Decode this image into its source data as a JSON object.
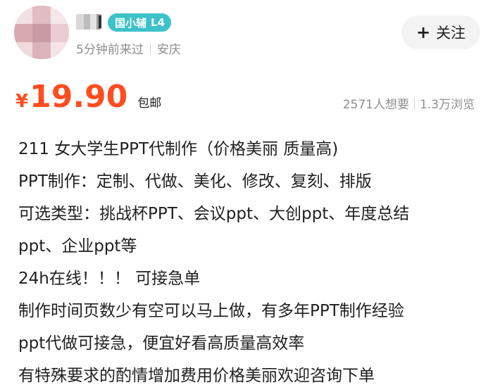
{
  "seller": {
    "level_badge": "国小辅",
    "level": "L4",
    "last_seen": "5分钟前来过",
    "location": "安庆"
  },
  "follow_button": {
    "icon": "plus-icon",
    "label": "关注"
  },
  "price": {
    "currency": "¥",
    "amount": "19.90",
    "shipping": "包邮"
  },
  "stats": {
    "wants": "2571人想要",
    "views": "1.3万浏览"
  },
  "description": {
    "lines": [
      "211 女大学生PPT代制作（价格美丽 质量高)",
      "PPT制作：定制、代做、美化、修改、复刻、排版",
      "可选类型：挑战杯PPT、会议ppt、大创ppt、年度总结",
      "ppt、企业ppt等",
      "24h在线！！！ 可接急单",
      "制作时间页数少有空可以马上做，有多年PPT制作经验",
      "ppt代做可接急，便宜好看高质量高效率",
      "有特殊要求的酌情增加费用价格美丽欢迎咨询下单"
    ]
  }
}
